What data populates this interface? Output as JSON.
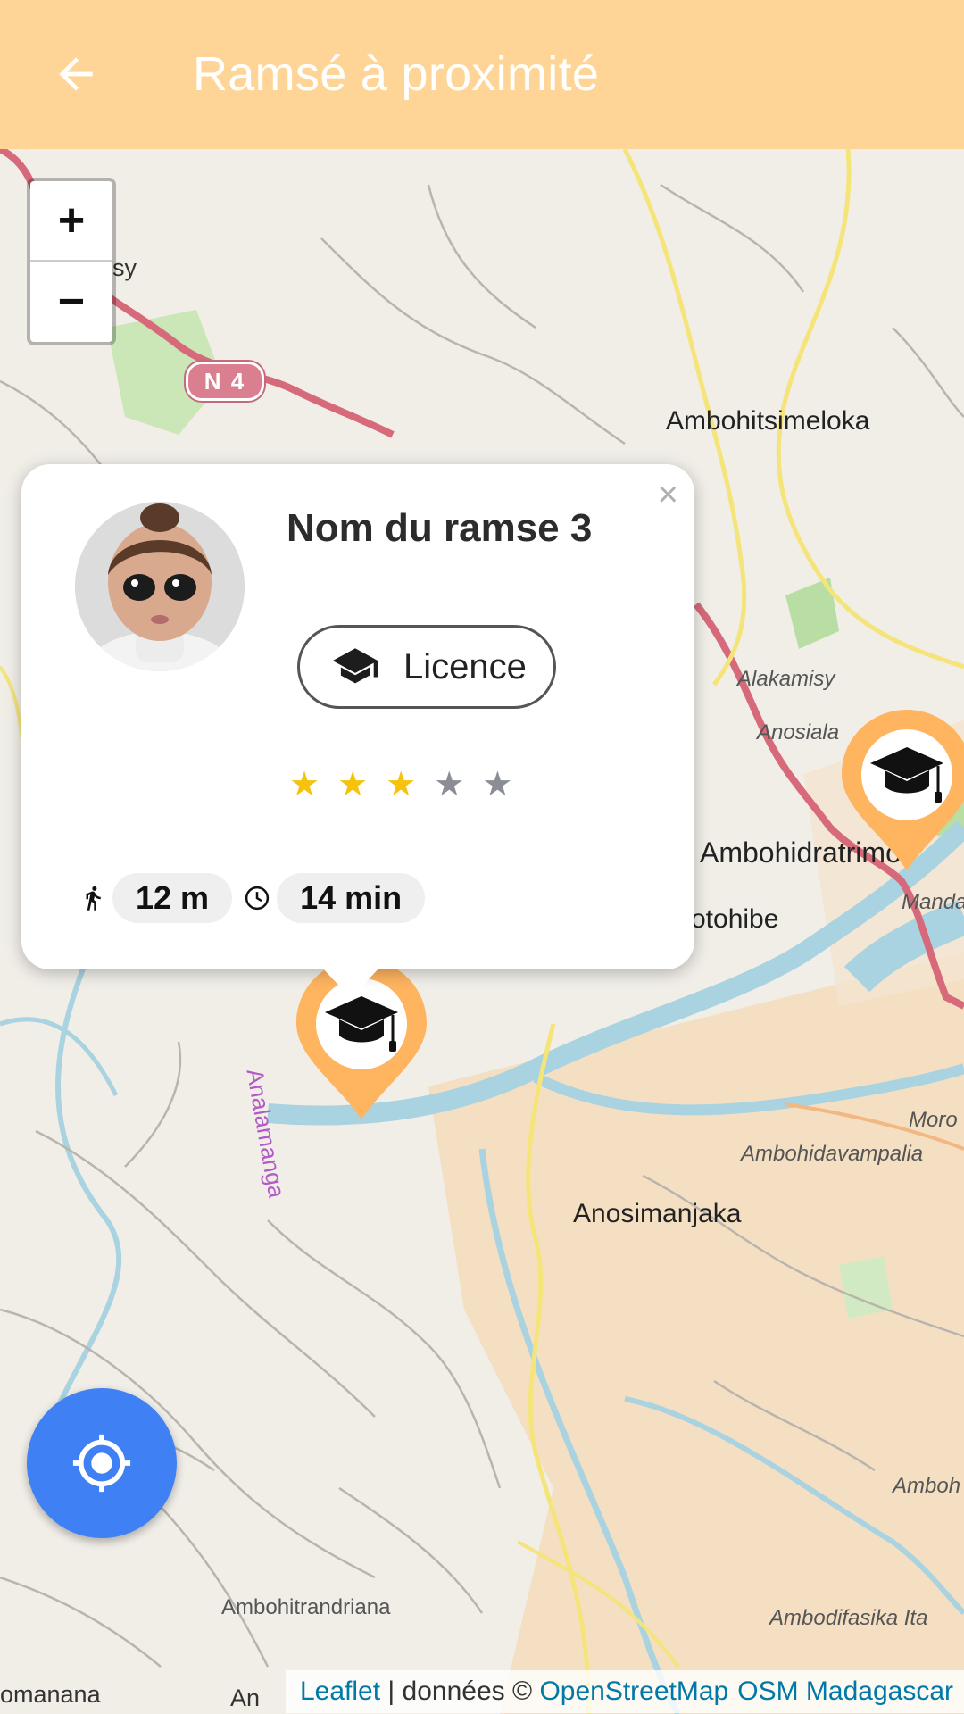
{
  "header": {
    "title": "Ramsé à proximité",
    "back_icon": "arrow-left-icon"
  },
  "colors": {
    "appbar": "#ffd597",
    "marker": "#ffb460",
    "fab": "#3f80f5",
    "star_on": "#f6c20c",
    "star_off": "#8a8d93"
  },
  "map": {
    "zoom_in": "+",
    "zoom_out": "−",
    "road_shield": "N 4",
    "labels": [
      {
        "text": "sy"
      },
      {
        "text": "Ambohitsimeloka"
      },
      {
        "text": "Alakamisy"
      },
      {
        "text": "Anosiala"
      },
      {
        "text": "Ambohidratrimo"
      },
      {
        "text": "Manda"
      },
      {
        "text": "otohibe"
      },
      {
        "text": "Analamanga"
      },
      {
        "text": "Anosimanjaka"
      },
      {
        "text": "Ambohidavampalia"
      },
      {
        "text": "Moro"
      },
      {
        "text": "Ambohitrandriana"
      },
      {
        "text": "Ambodifasika Ita"
      },
      {
        "text": "Amboh"
      },
      {
        "text": "omanana"
      },
      {
        "text": "An"
      }
    ],
    "marker_icon": "graduation-cap-icon"
  },
  "popup": {
    "name": "Nom du ramse 3",
    "chip_label": "Licence",
    "chip_icon": "graduation-cap-icon",
    "rating": 3,
    "rating_max": 5,
    "distance": "12 m",
    "distance_icon": "walking-icon",
    "duration": "14 min",
    "duration_icon": "clock-icon",
    "close": "×"
  },
  "fab": {
    "icon": "my-location-icon"
  },
  "attribution": {
    "leaflet": "Leaflet",
    "separator": " | données © ",
    "osm": "OpenStreetMap",
    "osm_mg": "OSM Madagascar"
  }
}
